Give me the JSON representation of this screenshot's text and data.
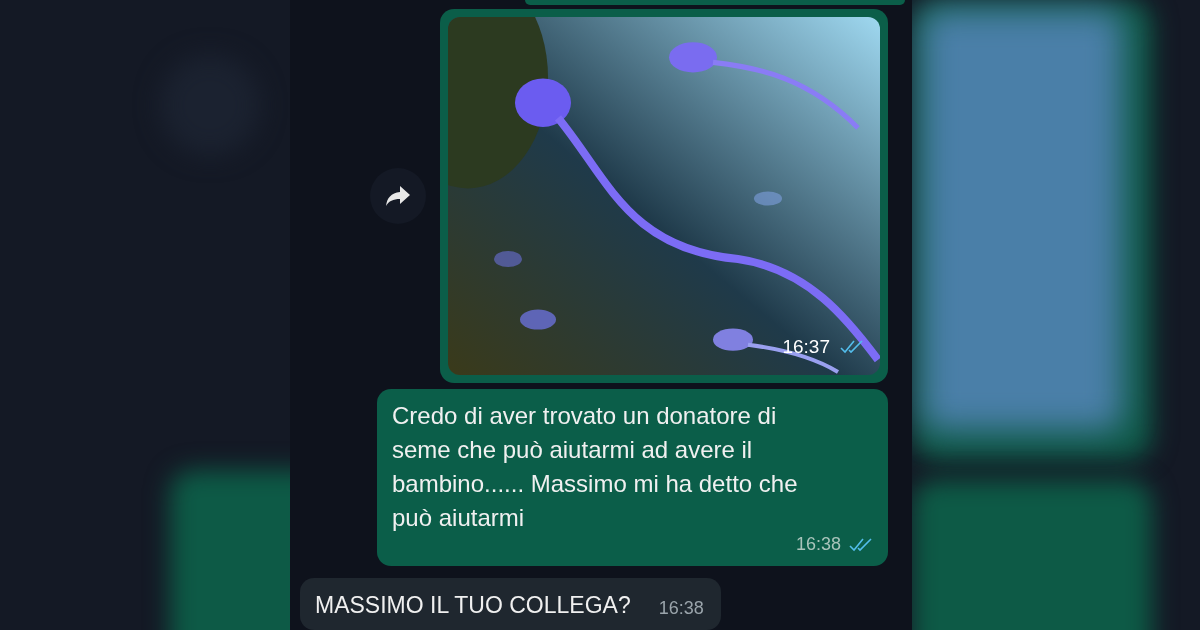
{
  "messages": [
    {
      "kind": "partial",
      "outgoing": true
    },
    {
      "outgoing": true,
      "time": "16:37",
      "read": true,
      "forward": true
    },
    {
      "kind": "text",
      "outgoing": true,
      "text": "Credo di aver trovato un donatore di seme che può aiutarmi ad avere il bambino...... Massimo mi ha detto che può aiutarmi",
      "time": "16:38",
      "read": true
    },
    {
      "kind": "text",
      "outgoing": false,
      "text": "MASSIMO IL TUO COLLEGA?",
      "time": "16:38"
    }
  ]
}
